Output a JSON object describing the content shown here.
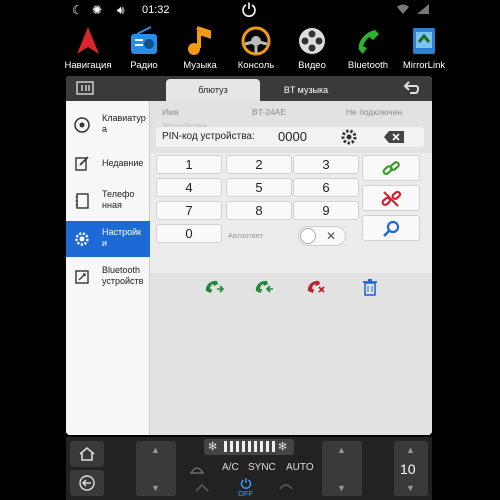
{
  "status": {
    "time": "01:32"
  },
  "apps": [
    {
      "label": "Навигация",
      "icon": "navigation-icon"
    },
    {
      "label": "Радио",
      "icon": "radio-icon"
    },
    {
      "label": "Музыка",
      "icon": "music-icon"
    },
    {
      "label": "Консоль",
      "icon": "console-icon"
    },
    {
      "label": "Видео",
      "icon": "video-icon"
    },
    {
      "label": "Bluetooth",
      "icon": "bluetooth-phone-icon"
    },
    {
      "label": "MirrorLink",
      "icon": "mirrorlink-icon"
    }
  ],
  "tabs": [
    {
      "label": "блютуз"
    },
    {
      "label": "BT музыка"
    }
  ],
  "sidebar": [
    {
      "label": "Клавиатура",
      "icon": "keypad-icon"
    },
    {
      "label": "Недавние",
      "icon": "recent-calls-icon"
    },
    {
      "label": "Телефонная",
      "icon": "contacts-icon"
    },
    {
      "label": "Настройки",
      "icon": "settings-gear-icon"
    },
    {
      "label": "Bluetooth устройств",
      "icon": "bluetooth-devices-icon"
    }
  ],
  "header": {
    "name_label": "Имя",
    "device_name": "BT-24AE",
    "conn_status": "Не подключен",
    "ghost_label": "Устройства"
  },
  "pin": {
    "label": "PIN-код устройства:",
    "value": "0000"
  },
  "keys": [
    "1",
    "2",
    "3",
    "4",
    "5",
    "6",
    "7",
    "8",
    "9",
    "0"
  ],
  "autoanswer": {
    "label": "Автоответ"
  },
  "bottom": {
    "ac": "A/C",
    "sync": "SYNC",
    "auto": "AUTO",
    "power": "OFF",
    "temp": "10"
  },
  "colors": {
    "accent": "#1d6ad6",
    "call_green": "#1f8a3a",
    "hangup_red": "#c0202a",
    "link_green": "#3a9a2a",
    "unlink_red": "#d02030"
  }
}
